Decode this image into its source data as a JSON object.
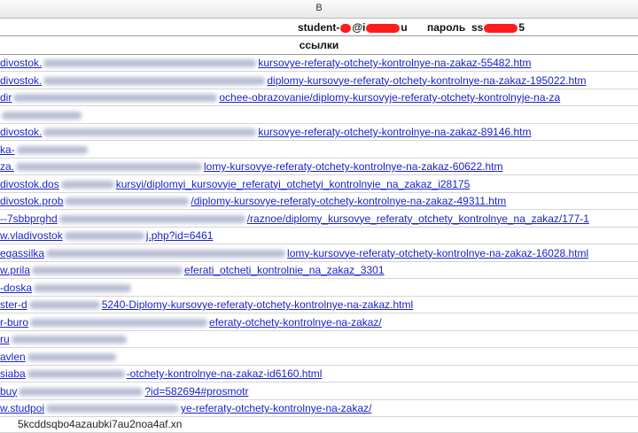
{
  "column_header": "B",
  "credentials": {
    "user_prefix": "student-",
    "user_mid": "@i",
    "user_suffix": "u",
    "password_label": "пароль",
    "password_prefix": "ss",
    "password_suffix": "5"
  },
  "section_title": "ссылки",
  "links": [
    {
      "before": "divostok.",
      "after": "kursovye-referaty-otchety-kontrolnye-na-zakaz-55482.htm"
    },
    {
      "before": "divostok.",
      "after": "diplomy-kursovye-referaty-otchety-kontrolnye-na-zakaz-195022.htm"
    },
    {
      "before": "dir",
      "after": "ochee-obrazovanie/diplomy-kursovyje-referaty-otchety-kontrolnyje-na-za"
    },
    {
      "before": "",
      "after": ""
    },
    {
      "before": "divostok.",
      "after": "kursovye-referaty-otchety-kontrolnye-na-zakaz-89146.htm"
    },
    {
      "before": "ka-",
      "after": ""
    },
    {
      "before": "za.",
      "after": "lomy-kursovye-referaty-otchety-kontrolnye-na-zakaz-60622.htm"
    },
    {
      "before": "divostok.dos",
      "after": "kursyi/diplomyi_kursovyie_referatyi_otchetyi_kontrolnyie_na_zakaz_i28175"
    },
    {
      "before": "divostok.prob",
      "after": "/diplomy-kursovye-referaty-otchety-kontrolnye-na-zakaz-49311.htm"
    },
    {
      "before": "--7sbbprghd",
      "after": "/raznoe/diplomy_kursovye_referaty_otchety_kontrolnye_na_zakaz/177-1"
    },
    {
      "before": "w.vladivostok",
      "after": "j.php?id=6461"
    },
    {
      "before": "egassilka",
      "after": "lomy-kursovye-referaty-otchety-kontrolnye-na-zakaz-16028.html"
    },
    {
      "before": "w.prila",
      "after": "eferati_otcheti_kontrolnie_na_zakaz_3301"
    },
    {
      "before": "-doska",
      "after": ""
    },
    {
      "before": "ster-d",
      "after": "5240-Diplomy-kursovye-referaty-otchety-kontrolnye-na-zakaz.html"
    },
    {
      "before": "r-buro",
      "after": "eferaty-otchety-kontrolnye-na-zakaz/"
    },
    {
      "before": "ru",
      "after": ""
    },
    {
      "before": "avlen",
      "after": ""
    },
    {
      "before": "siaba",
      "after": "-otchety-kontrolnye-na-zakaz-id6160.html"
    },
    {
      "before": "buy",
      "after": "?id=582694#prosmotr"
    },
    {
      "before": "w.studpoi",
      "after": "ye-referaty-otchety-kontrolnye-na-zakaz/"
    }
  ],
  "last_row_text": "5kcddsqbo4azaubki7au2noa4af.xn"
}
